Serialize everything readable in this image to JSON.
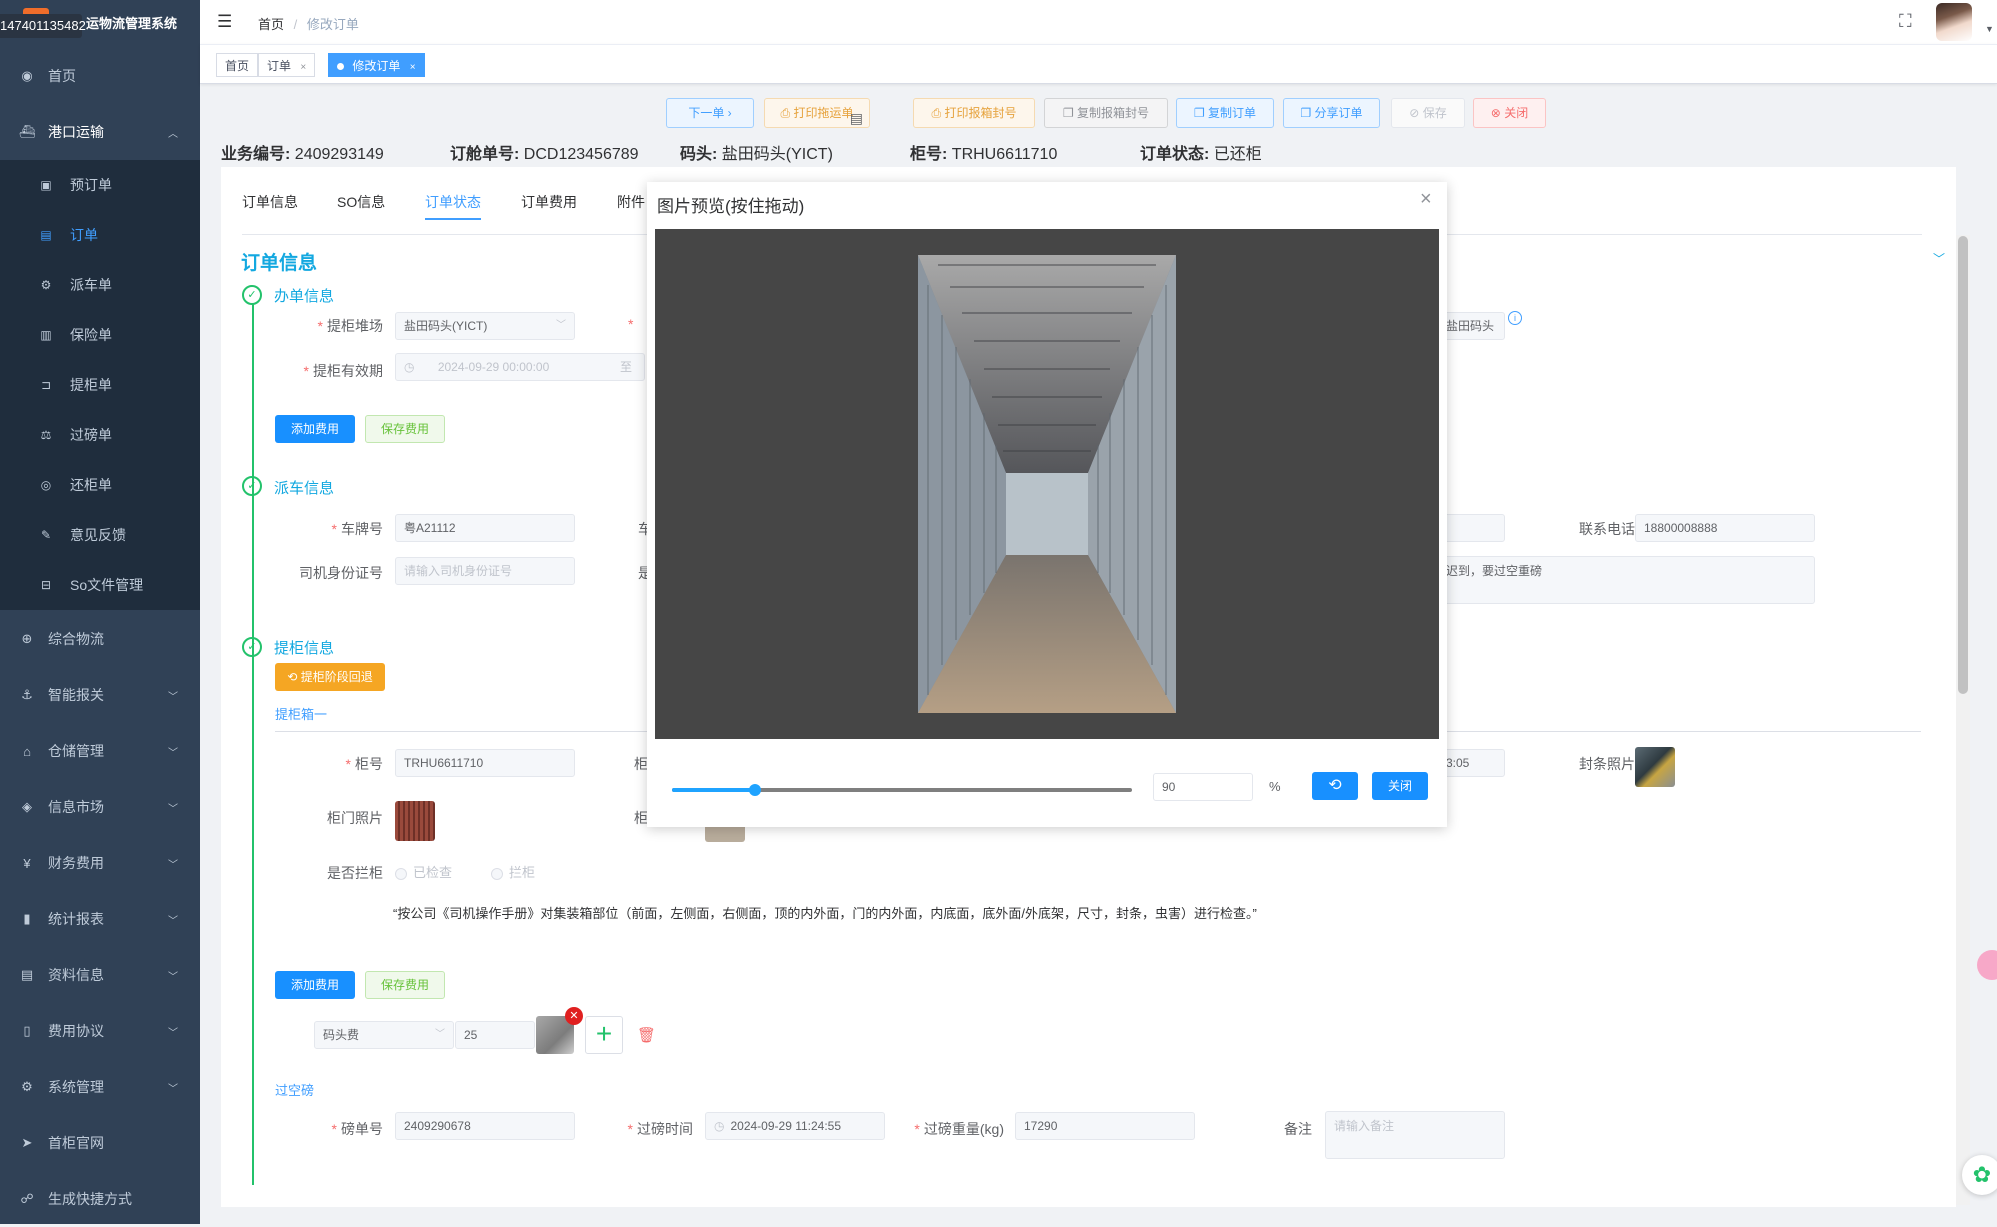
{
  "sidebar": {
    "badge": "147401135482",
    "app_title": "运物流管理系统",
    "items": [
      {
        "label": "首页",
        "icon": "dashboard-icon"
      },
      {
        "label": "港口运输",
        "icon": "ship-icon"
      },
      {
        "label": "综合物流",
        "icon": "globe-icon"
      },
      {
        "label": "智能报关",
        "icon": "anchor-icon"
      },
      {
        "label": "仓储管理",
        "icon": "warehouse-icon"
      },
      {
        "label": "信息市场",
        "icon": "market-icon"
      },
      {
        "label": "财务费用",
        "icon": "yen-icon"
      },
      {
        "label": "统计报表",
        "icon": "bar-chart-icon"
      },
      {
        "label": "资料信息",
        "icon": "document-icon"
      },
      {
        "label": "费用协议",
        "icon": "book-icon"
      },
      {
        "label": "系统管理",
        "icon": "gear-icon"
      },
      {
        "label": "首柜官网",
        "icon": "send-icon"
      },
      {
        "label": "生成快捷方式",
        "icon": "shortcut-icon"
      }
    ],
    "sub_items": [
      {
        "label": "预订单"
      },
      {
        "label": "订单"
      },
      {
        "label": "派车单"
      },
      {
        "label": "保险单"
      },
      {
        "label": "提柜单"
      },
      {
        "label": "过磅单"
      },
      {
        "label": "还柜单"
      },
      {
        "label": "意见反馈"
      },
      {
        "label": "So文件管理"
      }
    ]
  },
  "header": {
    "breadcrumb_home": "首页",
    "breadcrumb_sep": "/",
    "breadcrumb_current": "修改订单"
  },
  "tags": [
    {
      "label": "首页"
    },
    {
      "label": "订单",
      "close": "×"
    },
    {
      "label": "修改订单",
      "close": "×"
    }
  ],
  "actions": {
    "next": "下一单",
    "print_waybill": "打印拖运单",
    "print_seal": "打印报箱封号",
    "copy_seal": "复制报箱封号",
    "copy_order": "复制订单",
    "share_order": "分享订单",
    "save": "保存",
    "close": "关闭"
  },
  "order_info": {
    "biz_no_label": "业务编号:",
    "biz_no": "2409293149",
    "booking_label": "订舱单号:",
    "booking": "DCD123456789",
    "terminal_label": "码头:",
    "terminal": "盐田码头(YICT)",
    "container_label": "柜号:",
    "container": "TRHU6611710",
    "status_label": "订单状态:",
    "status": "已还柜"
  },
  "tabs": [
    "订单信息",
    "SO信息",
    "订单状态",
    "订单费用",
    "附件"
  ],
  "form": {
    "main_title": "订单信息",
    "sec1": "办单信息",
    "pickup_yard_label": "提柜堆场",
    "pickup_yard": "盐田码头(YICT)",
    "pickup_valid_label": "提柜有效期",
    "pickup_valid": "2024-09-29 00:00:00",
    "range_sep": "至",
    "right_yard_partial": "盐田码头",
    "add_fee": "添加费用",
    "save_fee": "保存费用",
    "sec2": "派车信息",
    "plate_label": "车牌号",
    "plate": "粤A21112",
    "phone_label": "联系电话",
    "phone": "18800008888",
    "driver_id_label": "司机身份证号",
    "driver_id_placeholder": "请输入司机身份证号",
    "remark_partial": "迟到，要过空重磅",
    "sec3": "提柜信息",
    "rollback": "提柜阶段回退",
    "box1": "提柜箱一",
    "container_no_label": "柜号",
    "container_no": "TRHU6611710",
    "time_partial": "3:05",
    "seal_photo_label": "封条照片",
    "door_photo_label": "柜门照片",
    "blocked_label": "是否拦柜",
    "opt_checked": "已检查",
    "opt_blocked": "拦柜",
    "inspection_note": "“按公司《司机操作手册》对集装箱部位（前面，左侧面，右侧面，顶的内外面，门的内外面，内底面，底外面/外底架，尺寸，封条，虫害）进行检查。”",
    "fee_type": "码头费",
    "fee_amount": "25",
    "sec_weigh": "过空磅",
    "weigh_no_label": "磅单号",
    "weigh_no": "2409290678",
    "weigh_time_label": "过磅时间",
    "weigh_time": "2024-09-29 11:24:55",
    "weigh_weight_label": "过磅重量(kg)",
    "weigh_weight": "17290",
    "remark_label": "备注",
    "remark_placeholder": "请输入备注"
  },
  "modal": {
    "title": "图片预览(按住拖动)",
    "close_x": "×",
    "zoom_value": "90",
    "zoom_fraction": 0.18,
    "percent": "%",
    "close_btn": "关闭"
  }
}
